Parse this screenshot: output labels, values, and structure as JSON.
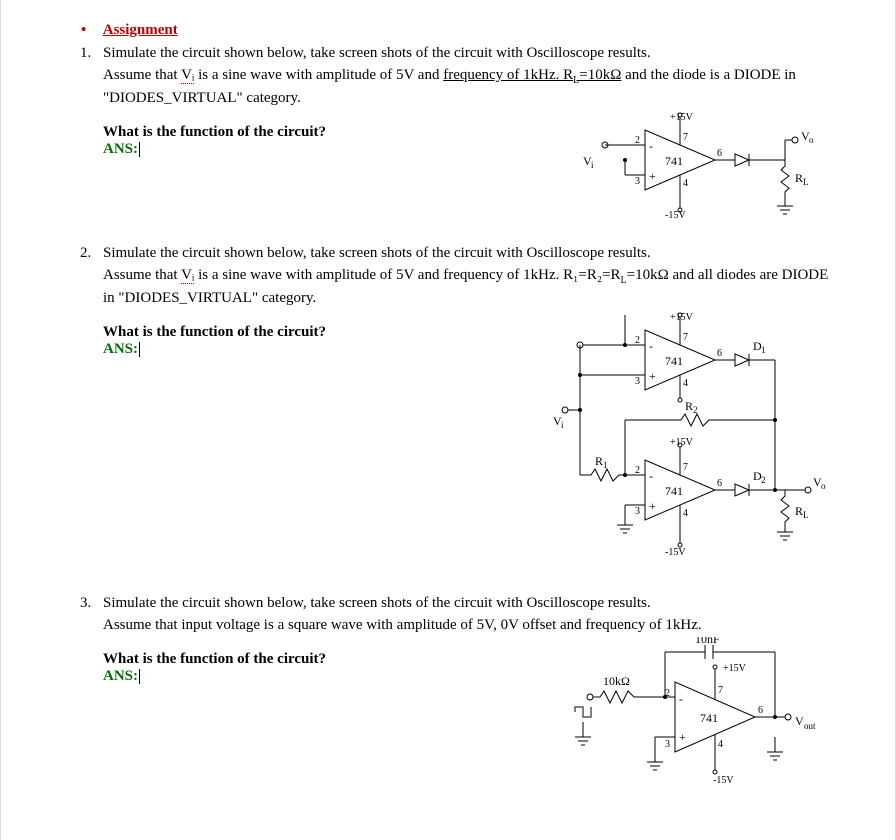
{
  "heading": "Assignment",
  "questions": [
    {
      "intro_a": "Simulate the circuit shown below, take screen shots of the circuit with Oscilloscope results.",
      "intro_b_pre": "Assume that ",
      "intro_b_vi": "Vᵢ",
      "intro_b_mid": " is a sine wave with amplitude of 5V and ",
      "intro_b_link": "frequency of 1kHz. R",
      "intro_b_rl_sub": "L",
      "intro_b_link2": "=10kΩ",
      "intro_b_post": " and the diode is a DIODE in \"DIODES_VIRTUAL\" category.",
      "prompt": "What is the function of the circuit?",
      "ans": "ANS:",
      "diag": {
        "plus15": "+15V",
        "minus15": "-15V",
        "opamp": "741",
        "vi": "V",
        "vi_sub": "i",
        "vo": "V",
        "vo_sub": "o",
        "rl": "R",
        "rl_sub": "L",
        "pin2": "2",
        "pin3": "3",
        "pin4": "4",
        "pin6": "6",
        "pin7": "7"
      }
    },
    {
      "intro_a": "Simulate the circuit shown below, take screen shots of the circuit with Oscilloscope results.",
      "intro_b_pre": "Assume that ",
      "intro_b_vi": "Vᵢ",
      "intro_b_mid": " is a sine wave with amplitude of 5V and frequency of 1kHz. R₁=R₂=R",
      "intro_b_rl_sub": "L",
      "intro_b_post": "=10kΩ and all diodes are DIODE in \"DIODES_VIRTUAL\" category.",
      "prompt": "What is the function of the circuit?",
      "ans": "ANS:",
      "diag": {
        "plus15": "+15V",
        "minus15": "-15V",
        "opamp": "741",
        "vi": "V",
        "vi_sub": "i",
        "vo": "V",
        "vo_sub": "o",
        "rl": "R",
        "rl_sub": "L",
        "r1": "R",
        "r1_sub": "1",
        "r2": "R",
        "r2_sub": "2",
        "d1": "D",
        "d1_sub": "1",
        "d2": "D",
        "d2_sub": "2",
        "pin2": "2",
        "pin3": "3",
        "pin4": "4",
        "pin6": "6",
        "pin7": "7"
      }
    },
    {
      "intro_a": "Simulate the circuit shown below, take screen shots of the circuit with Oscilloscope results.",
      "intro_b": "Assume that input voltage is a square wave with amplitude of 5V, 0V offset and frequency of 1kHz.",
      "prompt": "What is the function of the circuit?",
      "ans": "ANS:",
      "diag": {
        "plus15": "+15V",
        "minus15": "-15V",
        "opamp": "741",
        "cap": "10nF",
        "rin": "10kΩ",
        "vout": "V",
        "vout_sub": "out",
        "pin2": "2",
        "pin3": "3",
        "pin4": "4",
        "pin6": "6",
        "pin7": "7"
      }
    }
  ]
}
